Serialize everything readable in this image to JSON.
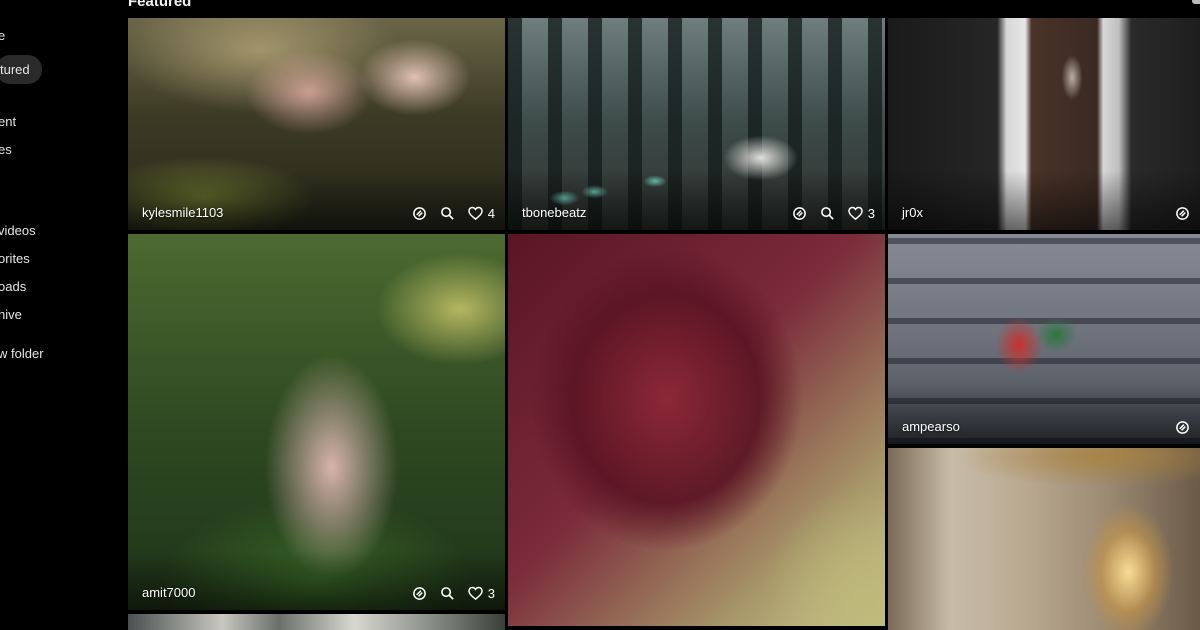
{
  "sidebar": {
    "items": [
      {
        "label": "e"
      },
      {
        "label": "tured"
      },
      {
        "label": "ent"
      },
      {
        "label": "es"
      },
      {
        "label": "videos"
      },
      {
        "label": "orites"
      },
      {
        "label": "oads"
      },
      {
        "label": "hive"
      },
      {
        "label": "w folder"
      }
    ]
  },
  "main": {
    "section_title": "Featured",
    "tiles": [
      {
        "user": "kylesmile1103",
        "likes": "4"
      },
      {
        "user": "tbonebeatz",
        "likes": "3"
      },
      {
        "user": "jr0x"
      },
      {
        "user": "amit7000",
        "likes": "3"
      },
      {
        "user": ""
      },
      {
        "user": "ampearso"
      },
      {
        "user": ""
      },
      {
        "user": ""
      }
    ]
  },
  "icons": {
    "remix": "remix-icon",
    "search": "search-icon",
    "like": "heart-icon"
  },
  "colors": {
    "background": "#000000",
    "active_nav": "#2a2a2a",
    "text": "#ffffff"
  }
}
